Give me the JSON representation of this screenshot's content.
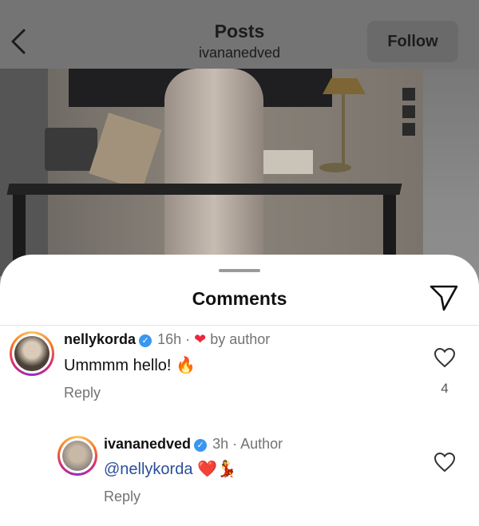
{
  "header": {
    "title": "Posts",
    "username": "ivananedved",
    "follow_label": "Follow"
  },
  "sheet": {
    "title": "Comments"
  },
  "comments": [
    {
      "username": "nellykorda",
      "time": "16h",
      "liked_by_author": "by author",
      "text": "Ummmm hello! 🔥",
      "reply_label": "Reply",
      "like_count": "4"
    }
  ],
  "reply": {
    "username": "ivananedved",
    "time": "3h",
    "badge": "Author",
    "mention": "@nellykorda",
    "text": " ❤️💃",
    "reply_label": "Reply"
  },
  "colors": {
    "accent_blue": "#3897f0",
    "like_red": "#e8283d",
    "mention": "#2a4e9a"
  }
}
